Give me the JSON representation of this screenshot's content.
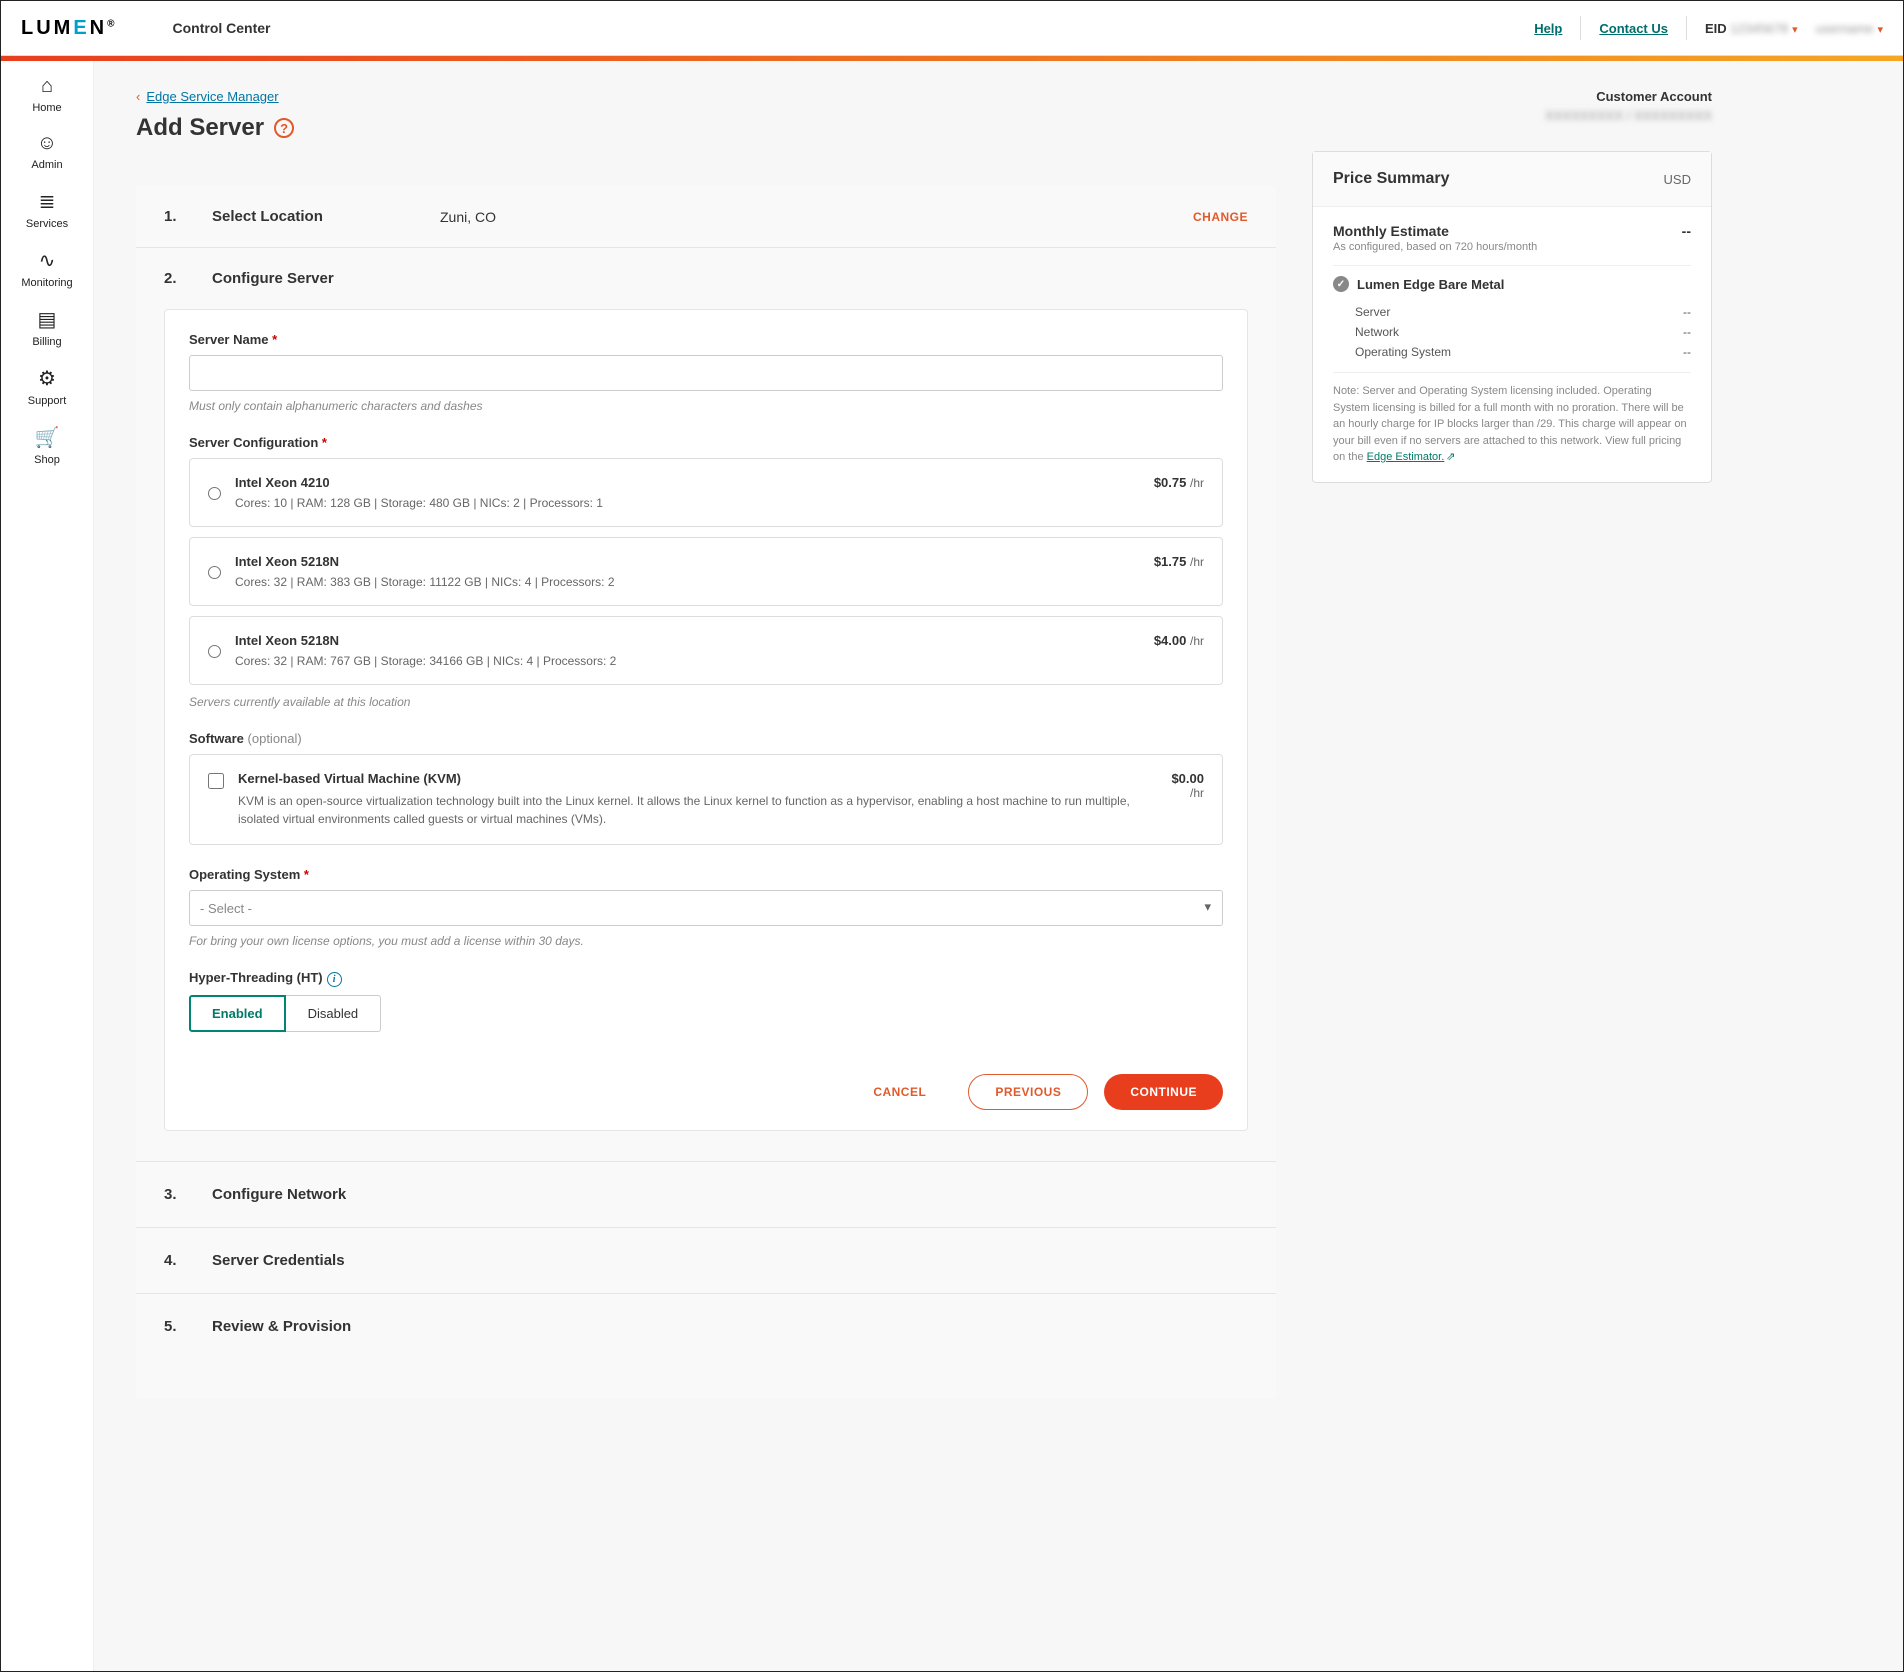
{
  "brand": "LUMEN",
  "app_title": "Control Center",
  "top_links": {
    "help": "Help",
    "contact": "Contact Us",
    "eid_label": "EID"
  },
  "leftnav": [
    {
      "icon": "⌂",
      "label": "Home"
    },
    {
      "icon": "☺",
      "label": "Admin"
    },
    {
      "icon": "≣",
      "label": "Services"
    },
    {
      "icon": "∿",
      "label": "Monitoring"
    },
    {
      "icon": "▤",
      "label": "Billing"
    },
    {
      "icon": "⚙",
      "label": "Support"
    },
    {
      "icon": "🛒",
      "label": "Shop"
    }
  ],
  "breadcrumb": {
    "back": "Edge Service Manager"
  },
  "page_title": "Add Server",
  "customer": {
    "label": "Customer Account"
  },
  "steps": {
    "s1": {
      "num": "1.",
      "title": "Select Location",
      "value": "Zuni, CO",
      "change": "CHANGE"
    },
    "s2": {
      "num": "2.",
      "title": "Configure Server"
    },
    "s3": {
      "num": "3.",
      "title": "Configure Network"
    },
    "s4": {
      "num": "4.",
      "title": "Server Credentials"
    },
    "s5": {
      "num": "5.",
      "title": "Review & Provision"
    }
  },
  "form": {
    "server_name_label": "Server Name",
    "server_name_hint": "Must only contain alphanumeric characters and dashes",
    "config_label": "Server Configuration",
    "configs": [
      {
        "name": "Intel Xeon 4210",
        "specs": "Cores: 10 | RAM: 128 GB | Storage: 480 GB | NICs: 2 | Processors: 1",
        "price": "$0.75",
        "unit": "/hr"
      },
      {
        "name": "Intel Xeon 5218N",
        "specs": "Cores: 32 | RAM: 383 GB | Storage: 11122 GB | NICs: 4 | Processors: 2",
        "price": "$1.75",
        "unit": "/hr"
      },
      {
        "name": "Intel Xeon 5218N",
        "specs": "Cores: 32 | RAM: 767 GB | Storage: 34166 GB | NICs: 4 | Processors: 2",
        "price": "$4.00",
        "unit": "/hr"
      }
    ],
    "config_hint": "Servers currently available at this location",
    "software_label": "Software",
    "software_opt": "(optional)",
    "software": {
      "name": "Kernel-based Virtual Machine (KVM)",
      "desc": "KVM is an open-source virtualization technology built into the Linux kernel. It allows the Linux kernel to function as a hypervisor, enabling a host machine to run multiple, isolated virtual environments called guests or virtual machines (VMs).",
      "price": "$0.00",
      "unit": "/hr"
    },
    "os_label": "Operating System",
    "os_placeholder": "- Select -",
    "os_hint": "For bring your own license options, you must add a license within 30 days.",
    "ht_label": "Hyper-Threading (HT)",
    "ht_enabled": "Enabled",
    "ht_disabled": "Disabled",
    "cancel": "CANCEL",
    "previous": "PREVIOUS",
    "continue": "CONTINUE"
  },
  "price": {
    "title": "Price Summary",
    "currency": "USD",
    "est_label": "Monthly Estimate",
    "est_val": "--",
    "est_sub": "As configured, based on 720 hours/month",
    "product": "Lumen Edge Bare Metal",
    "items": [
      {
        "label": "Server",
        "val": "--"
      },
      {
        "label": "Network",
        "val": "--"
      },
      {
        "label": "Operating System",
        "val": "--"
      }
    ],
    "note": "Note: Server and Operating System licensing included. Operating System licensing is billed for a full month with no proration. There will be an hourly charge for IP blocks larger than /29. This charge will appear on your bill even if no servers are attached to this network. View full pricing on the ",
    "note_link": "Edge Estimator."
  }
}
